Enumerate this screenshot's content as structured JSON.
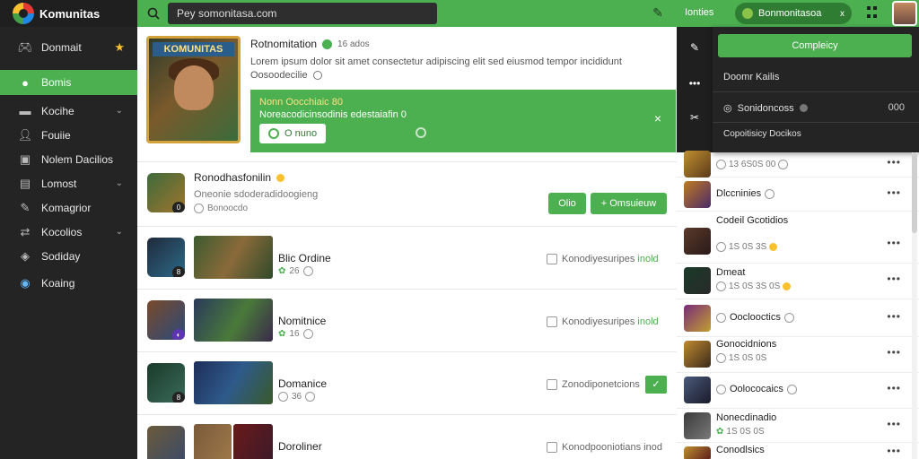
{
  "app": {
    "brand": "Komunitas"
  },
  "search": {
    "placeholder": "Pey somonitasa.com"
  },
  "topbar": {
    "link": "Ionties",
    "pill": "Bonmonitasoa",
    "pill_close": "x"
  },
  "sidebar": {
    "items": [
      {
        "label": "Donmait",
        "icon": "controller-icon"
      },
      {
        "label": "Bomis",
        "icon": "chat-icon"
      },
      {
        "label": "Kocihe",
        "icon": "folder-icon"
      },
      {
        "label": "Fouiie",
        "icon": "user-icon"
      },
      {
        "label": "Nolem Dacilios",
        "icon": "window-icon"
      },
      {
        "label": "Lomost",
        "icon": "box-icon"
      },
      {
        "label": "Komagrior",
        "icon": "pencil-icon"
      },
      {
        "label": "Kocolios",
        "icon": "share-icon"
      },
      {
        "label": "Sodiday",
        "icon": "tag-icon"
      },
      {
        "label": "Koaing",
        "icon": "globe-icon"
      }
    ]
  },
  "featured": {
    "art_title": "KOMUNITAS",
    "title": "Rotnomitation",
    "sub": "16 ados",
    "desc": "Lorem ipsum dolor sit amet consectetur adipiscing elit sed eiusmod tempor incididunt",
    "desc2": "Oosoodecilie",
    "banner_title": "Nonn Oocchiaic 80",
    "banner_text": "Noreacodicinsodinis edestaiafin 0",
    "banner_btn": "O nuno",
    "banner_close": "×"
  },
  "suggested": {
    "title": "Ronodhasfonilin",
    "desc": "Oneonie sdoderadidoogieng",
    "meta": "Bonoocdo",
    "btn1": "Olio",
    "btn2": "+ Omsuieuw"
  },
  "rows": [
    {
      "title": "Blic Ordine",
      "meta": "26",
      "action": "Konodiyesuripes",
      "action_ok": "inold"
    },
    {
      "title": "Nomitnice",
      "meta": "16",
      "action": "Konodiyesuripes",
      "action_ok": "inold"
    },
    {
      "title": "Domanice",
      "meta": "36",
      "action": "Zonodiponetcions",
      "action_ok": "✓"
    },
    {
      "title": "Doroliner",
      "meta": "",
      "action": "Konodpooniotians",
      "action_ok": "inod"
    }
  ],
  "right": {
    "strip": [
      "✎",
      "•••",
      "✂"
    ],
    "dropdown": {
      "btn": "Compleicy",
      "line1": "Doomr Kailis",
      "line2": "Sonidoncoss",
      "line2_right": "000",
      "line3": "Copoitisicy Docikos"
    },
    "list": [
      {
        "title": "",
        "meta": "13 6S0S 00"
      },
      {
        "title": "Dlccninies",
        "meta": ""
      },
      {
        "title": "Codeil Gcotidios",
        "meta": "1S 0S 3S"
      },
      {
        "title": "Dmeat",
        "meta": "1S 0S 3S 0S"
      },
      {
        "title": "Ooclooctics",
        "meta": ""
      },
      {
        "title": "Gonocidnions",
        "meta": "1S 0S 0S"
      },
      {
        "title": "Oolococaics",
        "meta": ""
      },
      {
        "title": "Nonecdinadio",
        "meta": "1S 0S 0S"
      },
      {
        "title": "Conodlsics",
        "meta": ""
      }
    ]
  }
}
